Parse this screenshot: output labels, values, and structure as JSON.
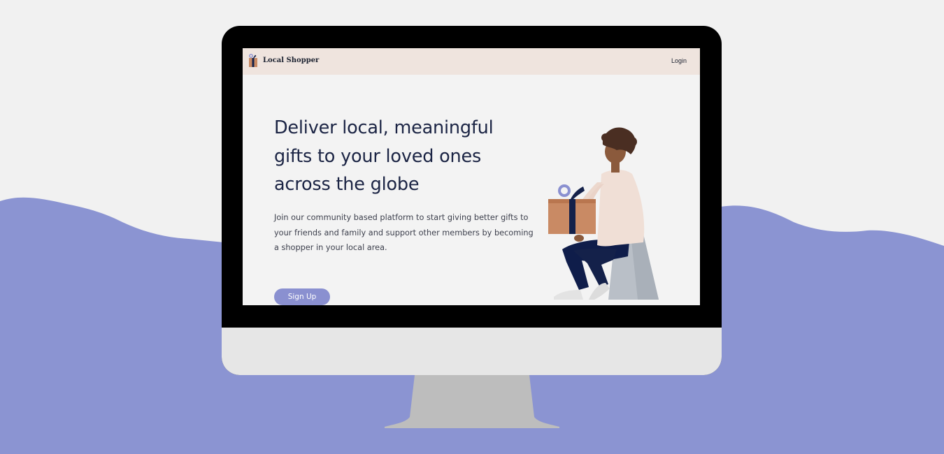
{
  "header": {
    "brand_name": "Local Shopper",
    "login_label": "Login"
  },
  "hero": {
    "heading": "Deliver local, meaningful gifts to your loved ones across the globe",
    "description": "Join our community based platform to start giving better gifts to your friends and family and support other members by becoming a shopper in your local area.",
    "signup_label": "Sign Up"
  },
  "icons": {
    "brand": "gift-box-logo-icon"
  },
  "colors": {
    "page_background": "#f1f1f1",
    "backdrop_wave": "#8b94d2",
    "header_background": "#efe4de",
    "heading_text": "#1b2444",
    "accent": "#8a90d0",
    "gift_box": "#c98a64",
    "ribbon": "#14214a",
    "monitor_bezel": "#000000",
    "monitor_chin": "#e6e6e6",
    "monitor_stand": "#bdbdbd"
  }
}
